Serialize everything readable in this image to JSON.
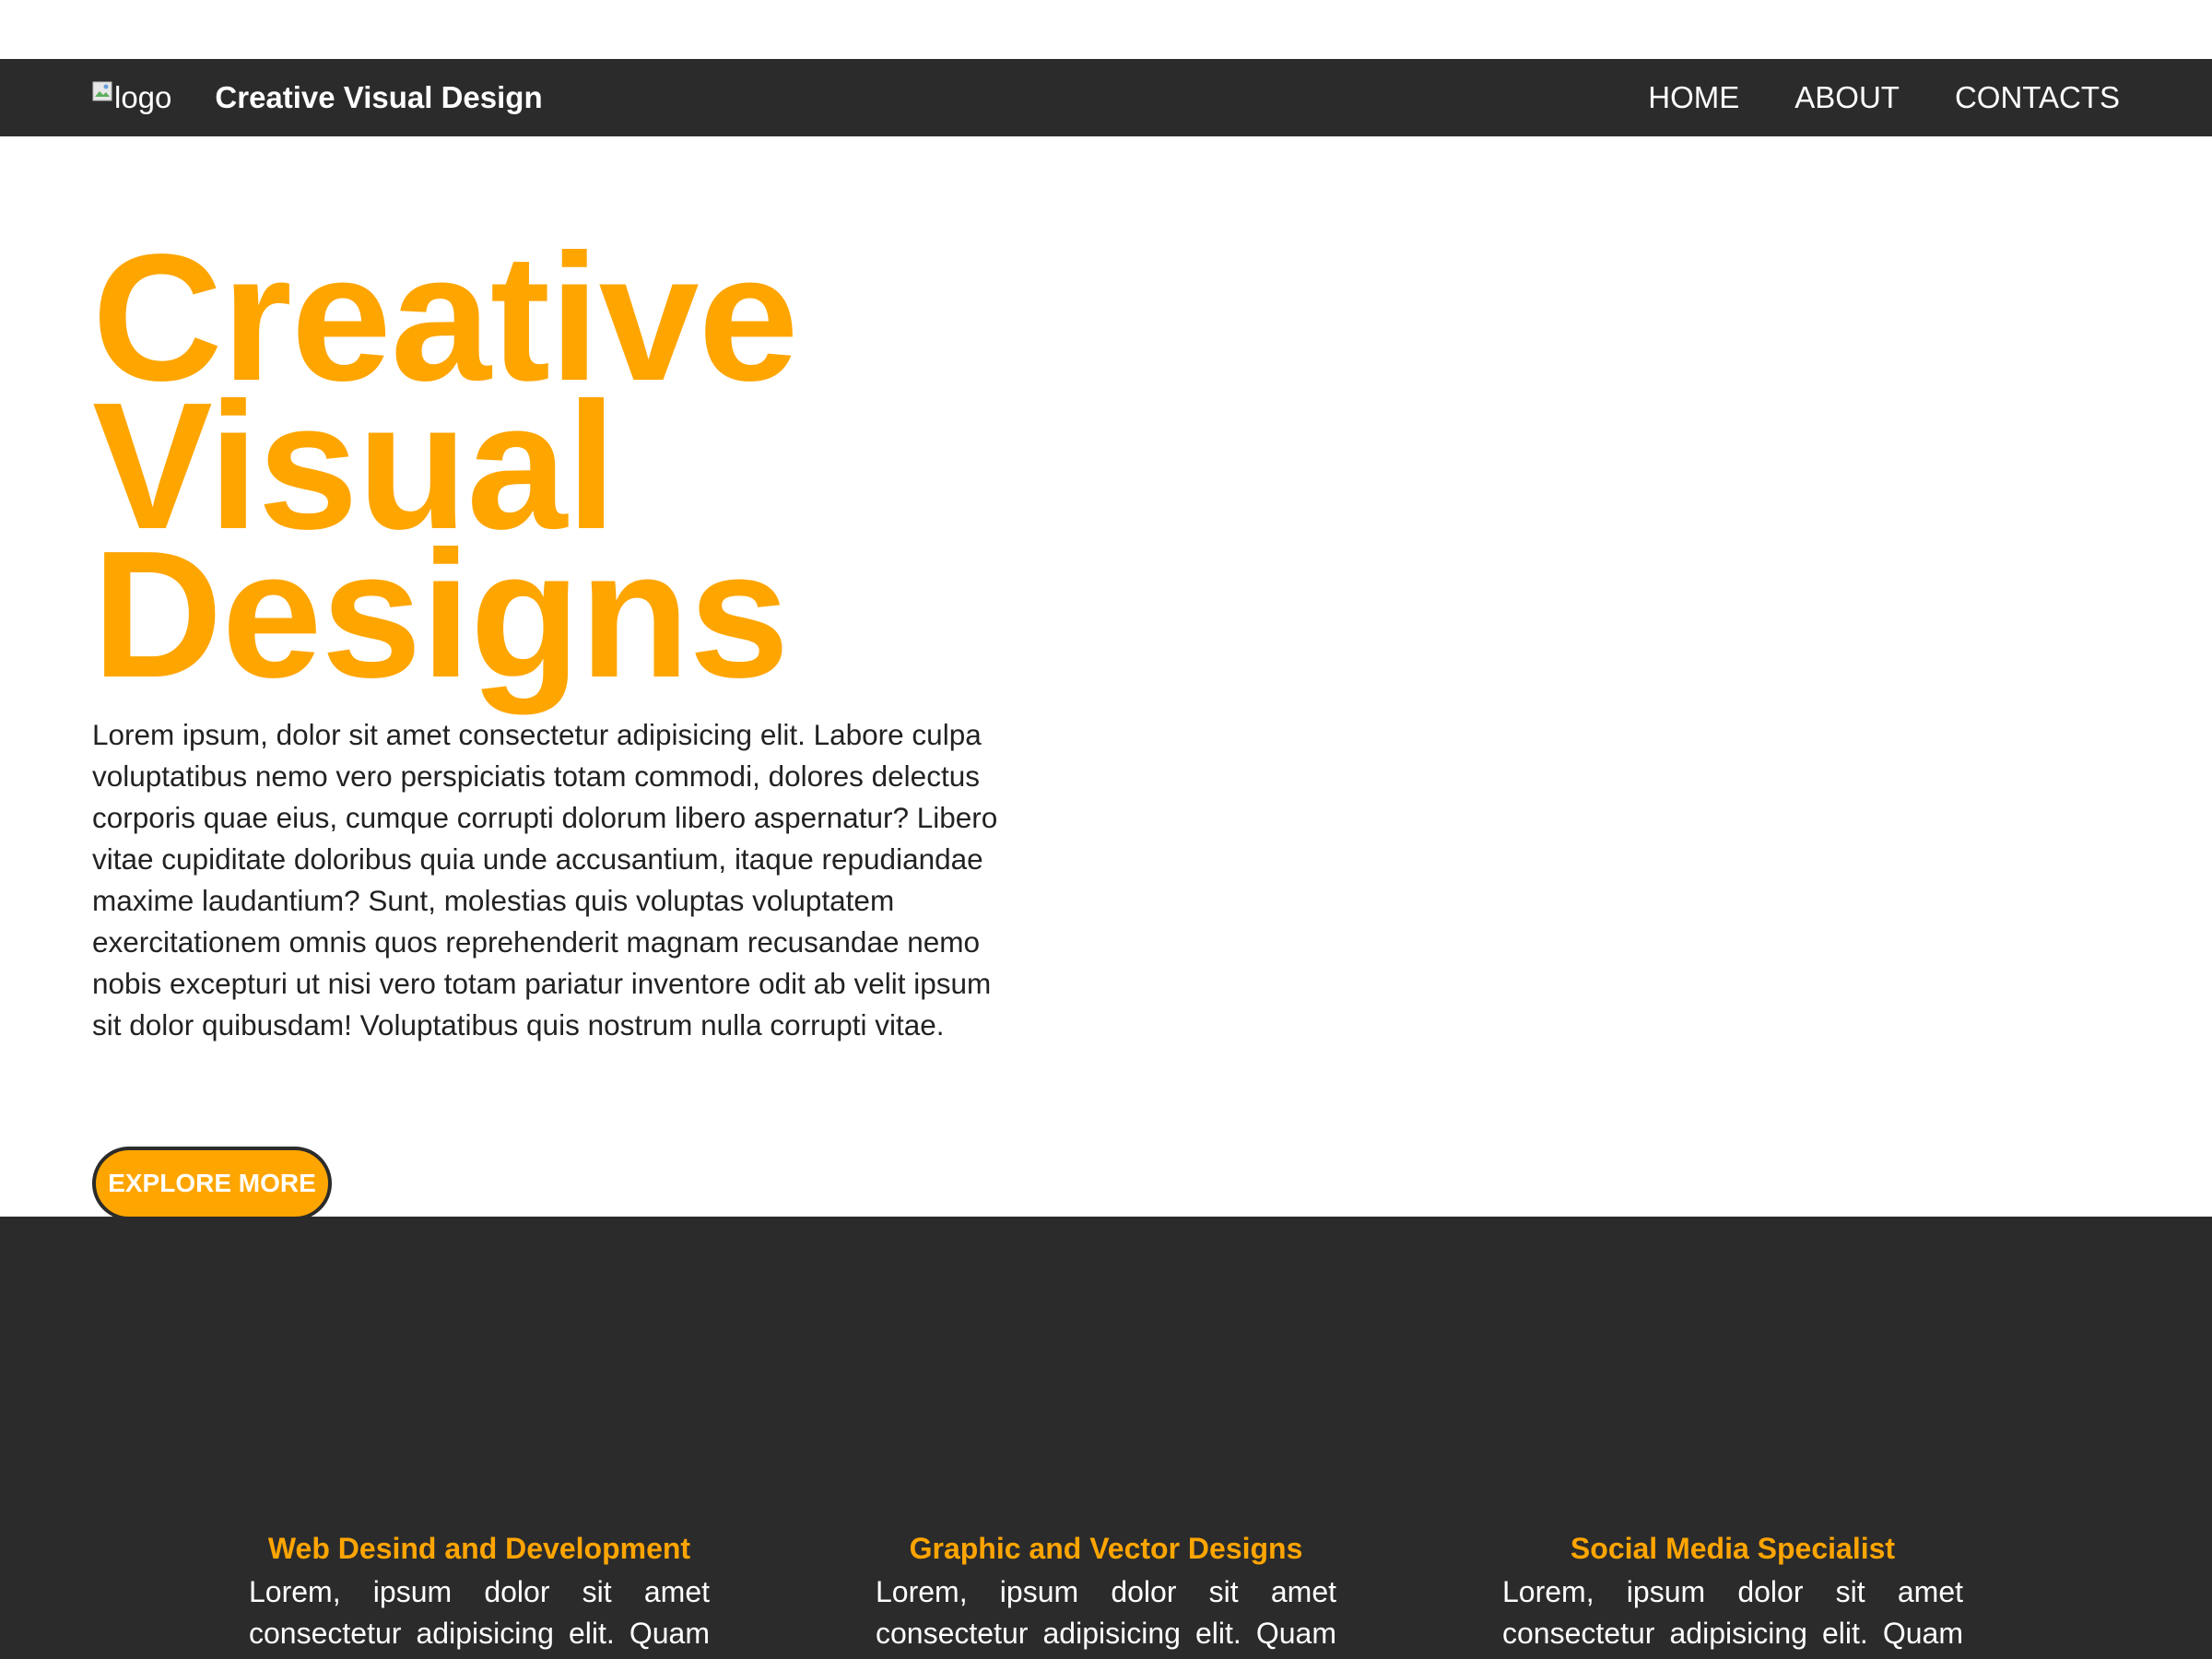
{
  "navbar": {
    "logo_alt": "logo",
    "brand": "Creative Visual Design",
    "links": [
      "HOME",
      "ABOUT",
      "CONTACTS"
    ]
  },
  "hero": {
    "title_lines": [
      "Creative",
      "Visual",
      "Designs"
    ],
    "paragraph": "Lorem ipsum, dolor sit amet consectetur adipisicing elit. Labore culpa voluptatibus nemo vero perspiciatis totam commodi, dolores delectus corporis quae eius, cumque corrupti dolorum libero aspernatur? Libero vitae cupiditate doloribus quia unde accusantium, itaque repudiandae maxime laudantium? Sunt, molestias quis voluptas voluptatem exercitationem omnis quos reprehenderit magnam recusandae nemo nobis excepturi ut nisi vero totam pariatur inventore odit ab velit ipsum sit dolor quibusdam! Voluptatibus quis nostrum nulla corrupti vitae.",
    "button": "EXPLORE MORE"
  },
  "services": [
    {
      "title": "Web Desind and Development",
      "text": "Lorem, ipsum dolor sit amet consectetur adipisicing elit. Quam"
    },
    {
      "title": "Graphic and Vector Designs",
      "text": "Lorem, ipsum dolor sit amet consectetur adipisicing elit. Quam"
    },
    {
      "title": "Social Media Specialist",
      "text": "Lorem, ipsum dolor sit amet consectetur adipisicing elit. Quam"
    }
  ],
  "colors": {
    "accent": "#ffa500",
    "dark": "#2b2b2b",
    "text": "#222222",
    "white": "#ffffff"
  },
  "icons": {
    "logo": "broken-image-icon"
  }
}
